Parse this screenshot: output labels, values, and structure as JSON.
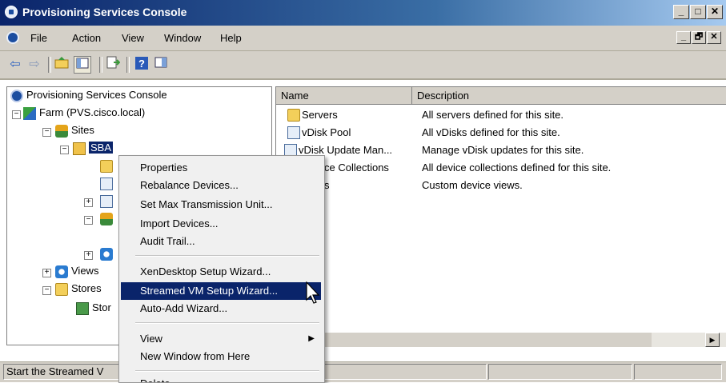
{
  "window": {
    "title": "Provisioning Services Console",
    "caption_buttons": [
      "_",
      "□",
      "✕"
    ]
  },
  "menubar": {
    "items": [
      "File",
      "Action",
      "View",
      "Window",
      "Help"
    ],
    "mdi_buttons": [
      "_",
      "🗗",
      "✕"
    ]
  },
  "toolbar": {
    "buttons": [
      "back-icon",
      "forward-icon",
      "up-folder-icon",
      "show-hide-tree-icon",
      "export-list-icon",
      "help-icon",
      "properties-pane-icon"
    ]
  },
  "tree": {
    "root": "Provisioning Services Console",
    "farm": "Farm (PVS.cisco.local)",
    "sites": "Sites",
    "site_sba": "SBA",
    "views": "Views",
    "stores": "Stores",
    "store_child": "Stor"
  },
  "list": {
    "columns": [
      "Name",
      "Description"
    ],
    "rows": [
      {
        "name": "Servers",
        "description": "All servers defined for this site."
      },
      {
        "name": "vDisk Pool",
        "description": "All vDisks defined for this site."
      },
      {
        "name": "vDisk Update Man...",
        "description": "Manage vDisk updates for this site."
      },
      {
        "name": "ce Collections",
        "description": "All device collections defined for this site."
      },
      {
        "name": "s",
        "description": "Custom device views."
      }
    ]
  },
  "context_menu": {
    "items": [
      "Properties",
      "Rebalance Devices...",
      "Set Max Transmission Unit...",
      "Import Devices...",
      "Audit Trail...",
      "XenDesktop Setup Wizard...",
      "Streamed VM Setup Wizard...",
      "Auto-Add Wizard...",
      "View",
      "New Window from Here",
      "Delete"
    ],
    "highlighted": "Streamed VM Setup Wizard..."
  },
  "statusbar": {
    "text": "Start the Streamed V"
  },
  "colors": {
    "title_bar": "#0a246a",
    "highlight": "#0a246a",
    "chrome": "#d4d0c8"
  }
}
